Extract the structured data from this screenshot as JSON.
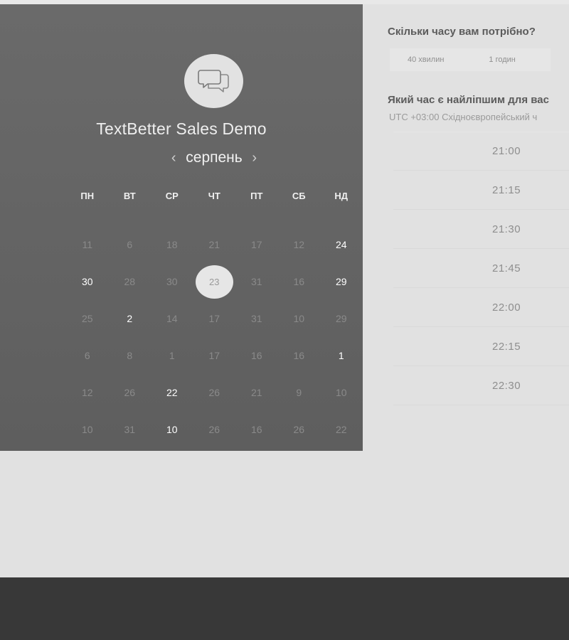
{
  "event": {
    "title": "TextBetter Sales Demo",
    "icon": "chat-bubbles-icon"
  },
  "calendar": {
    "month": "серпень",
    "prev_icon": "‹",
    "next_icon": "›",
    "weekdays": [
      "ПН",
      "ВТ",
      "СР",
      "ЧТ",
      "ПТ",
      "СБ",
      "НД"
    ],
    "weeks": [
      [
        {
          "d": "11",
          "a": false
        },
        {
          "d": "6",
          "a": false
        },
        {
          "d": "18",
          "a": false
        },
        {
          "d": "21",
          "a": false
        },
        {
          "d": "17",
          "a": false
        },
        {
          "d": "12",
          "a": false
        },
        {
          "d": "24",
          "a": true
        }
      ],
      [
        {
          "d": "30",
          "a": true
        },
        {
          "d": "28",
          "a": false
        },
        {
          "d": "30",
          "a": false
        },
        {
          "d": "23",
          "a": false,
          "sel": true
        },
        {
          "d": "31",
          "a": false
        },
        {
          "d": "16",
          "a": false
        },
        {
          "d": "29",
          "a": true
        }
      ],
      [
        {
          "d": "25",
          "a": false
        },
        {
          "d": "2",
          "a": true
        },
        {
          "d": "14",
          "a": false
        },
        {
          "d": "17",
          "a": false
        },
        {
          "d": "31",
          "a": false
        },
        {
          "d": "10",
          "a": false
        },
        {
          "d": "29",
          "a": false
        }
      ],
      [
        {
          "d": "6",
          "a": false
        },
        {
          "d": "8",
          "a": false
        },
        {
          "d": "1",
          "a": false
        },
        {
          "d": "17",
          "a": false
        },
        {
          "d": "16",
          "a": false
        },
        {
          "d": "16",
          "a": false
        },
        {
          "d": "1",
          "a": true
        }
      ],
      [
        {
          "d": "12",
          "a": false
        },
        {
          "d": "26",
          "a": false
        },
        {
          "d": "22",
          "a": true
        },
        {
          "d": "26",
          "a": false
        },
        {
          "d": "21",
          "a": false
        },
        {
          "d": "9",
          "a": false
        },
        {
          "d": "10",
          "a": false
        }
      ],
      [
        {
          "d": "10",
          "a": false
        },
        {
          "d": "31",
          "a": false
        },
        {
          "d": "10",
          "a": true
        },
        {
          "d": "26",
          "a": false
        },
        {
          "d": "16",
          "a": false
        },
        {
          "d": "26",
          "a": false
        },
        {
          "d": "22",
          "a": false
        }
      ]
    ]
  },
  "duration": {
    "question": "Скільки часу вам потрібно?",
    "options": [
      "40 хвилин",
      "1 годин"
    ]
  },
  "time": {
    "question": "Який час є найліпшим для вас",
    "timezone": "UTC +03:00 Східноєвропейський ч",
    "slots": [
      "21:00",
      "21:15",
      "21:30",
      "21:45",
      "22:00",
      "22:15",
      "22:30"
    ]
  }
}
